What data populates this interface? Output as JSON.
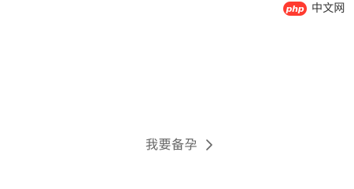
{
  "watermark": {
    "logo_text": "php",
    "site_text": "中文网",
    "logo_color": "#ff3b30"
  },
  "cta": {
    "label": "我要备孕",
    "icon": "chevron-right-icon",
    "text_color": "#666666"
  }
}
